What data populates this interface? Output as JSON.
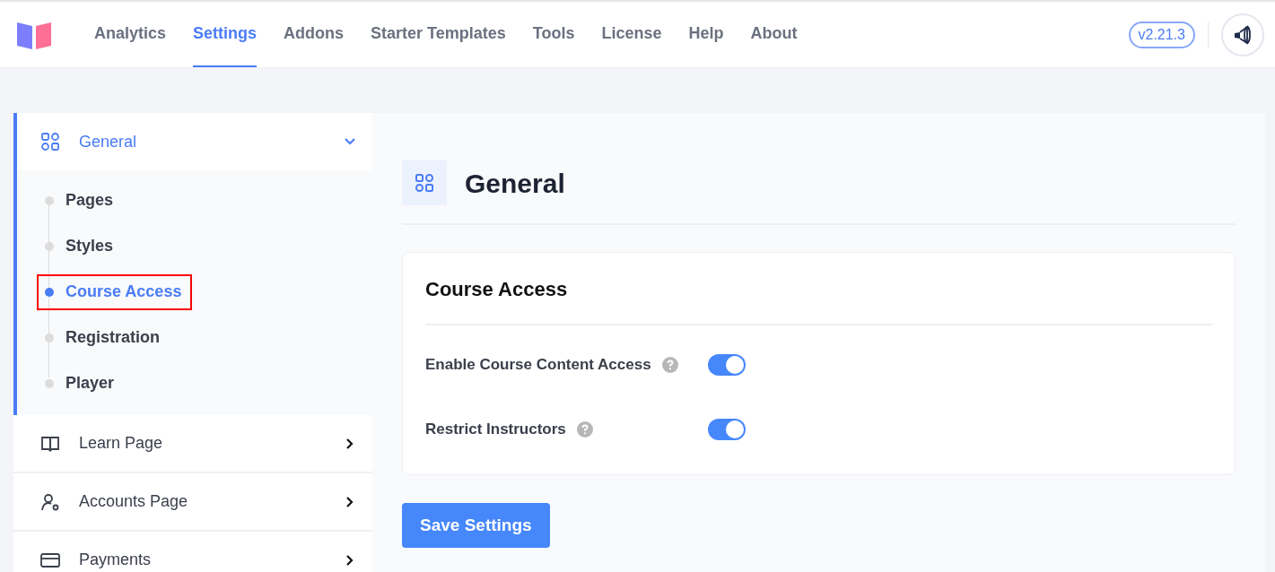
{
  "nav": [
    {
      "label": "Analytics",
      "selected": false
    },
    {
      "label": "Settings",
      "selected": true
    },
    {
      "label": "Addons",
      "selected": false
    },
    {
      "label": "Starter Templates",
      "selected": false
    },
    {
      "label": "Tools",
      "selected": false
    },
    {
      "label": "License",
      "selected": false
    },
    {
      "label": "Help",
      "selected": false
    },
    {
      "label": "About",
      "selected": false
    }
  ],
  "version": "v2.21.3",
  "sidebar": {
    "items": [
      {
        "label": "General",
        "kind": "grid",
        "expanded": true,
        "children": [
          {
            "label": "Pages",
            "selected": false,
            "highlighted": false
          },
          {
            "label": "Styles",
            "selected": false,
            "highlighted": false
          },
          {
            "label": "Course Access",
            "selected": true,
            "highlighted": true
          },
          {
            "label": "Registration",
            "selected": false,
            "highlighted": false
          },
          {
            "label": "Player",
            "selected": false,
            "highlighted": false
          }
        ]
      },
      {
        "label": "Learn Page",
        "kind": "book",
        "expanded": false
      },
      {
        "label": "Accounts Page",
        "kind": "user-gear",
        "expanded": false
      },
      {
        "label": "Payments",
        "kind": "card",
        "expanded": false
      }
    ]
  },
  "main": {
    "title": "General",
    "section": {
      "title": "Course Access",
      "settings": [
        {
          "label": "Enable Course Content Access",
          "on": true
        },
        {
          "label": "Restrict Instructors",
          "on": true
        }
      ]
    },
    "save_button": "Save Settings"
  }
}
